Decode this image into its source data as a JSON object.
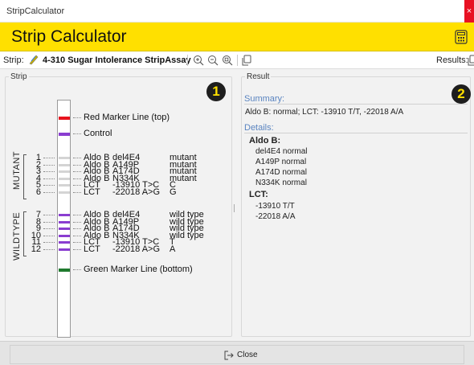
{
  "window": {
    "title": "StripCalculator",
    "close_glyph": "×"
  },
  "header": {
    "title": "Strip Calculator",
    "icon": "calculator-icon"
  },
  "toolbar": {
    "strip_label": "Strip:",
    "strip_name": "4-310 Sugar Intolerance StripAssay",
    "results_label": "Results:",
    "buttons": [
      "zoom-in-icon",
      "zoom-out-icon",
      "zoom-fit-icon",
      "copy-icon"
    ]
  },
  "strip_panel": {
    "caption": "Strip",
    "badge": "1",
    "group_labels": {
      "mutant": "MUTANT",
      "wildtype": "WILDTYPE"
    },
    "markers": [
      {
        "label": "Red Marker Line (top)",
        "color": "#e8141e"
      },
      {
        "label": "Control",
        "color": "#8a3dd0"
      },
      {
        "label": "Green Marker Line (bottom)",
        "color": "#1f7a2e"
      }
    ],
    "lines": [
      {
        "num": "1",
        "gene": "Aldo B",
        "variant": "del4E4",
        "result": "mutant",
        "color": "#d4d4d4"
      },
      {
        "num": "2",
        "gene": "Aldo B",
        "variant": "A149P",
        "result": "mutant",
        "color": "#d4d4d4"
      },
      {
        "num": "3",
        "gene": "Aldo B",
        "variant": "A174D",
        "result": "mutant",
        "color": "#d4d4d4"
      },
      {
        "num": "4",
        "gene": "Aldo B",
        "variant": "N334K",
        "result": "mutant",
        "color": "#d4d4d4"
      },
      {
        "num": "5",
        "gene": "LCT",
        "variant": "-13910 T>C",
        "result": "C",
        "color": "#d4d4d4"
      },
      {
        "num": "6",
        "gene": "LCT",
        "variant": "-22018 A>G",
        "result": "G",
        "color": "#d4d4d4"
      },
      {
        "num": "7",
        "gene": "Aldo B",
        "variant": "del4E4",
        "result": "wild type",
        "color": "#8a3dd0"
      },
      {
        "num": "8",
        "gene": "Aldo B",
        "variant": "A149P",
        "result": "wild type",
        "color": "#8a3dd0"
      },
      {
        "num": "9",
        "gene": "Aldo B",
        "variant": "A174D",
        "result": "wild type",
        "color": "#8a3dd0"
      },
      {
        "num": "10",
        "gene": "Aldo B",
        "variant": "N334K",
        "result": "wild type",
        "color": "#8a3dd0"
      },
      {
        "num": "11",
        "gene": "LCT",
        "variant": "-13910 T>C",
        "result": "T",
        "color": "#8a3dd0"
      },
      {
        "num": "12",
        "gene": "LCT",
        "variant": "-22018 A>G",
        "result": "A",
        "color": "#8a3dd0"
      }
    ]
  },
  "result_panel": {
    "caption": "Result",
    "badge": "2",
    "summary_title": "Summary:",
    "summary_text": "Aldo B: normal; LCT: -13910 T/T, -22018 A/A",
    "details_title": "Details:",
    "groups": [
      {
        "name": "Aldo B:",
        "items": [
          "del4E4 normal",
          "A149P normal",
          "A174D normal",
          "N334K normal"
        ]
      },
      {
        "name": "LCT:",
        "items": [
          "-13910 T/T",
          "-22018 A/A"
        ]
      }
    ]
  },
  "footer": {
    "close_label": "Close"
  },
  "colors": {
    "accent": "#ffe000",
    "section_title": "#5a84c0",
    "badge_bg": "#1e1e1e"
  }
}
